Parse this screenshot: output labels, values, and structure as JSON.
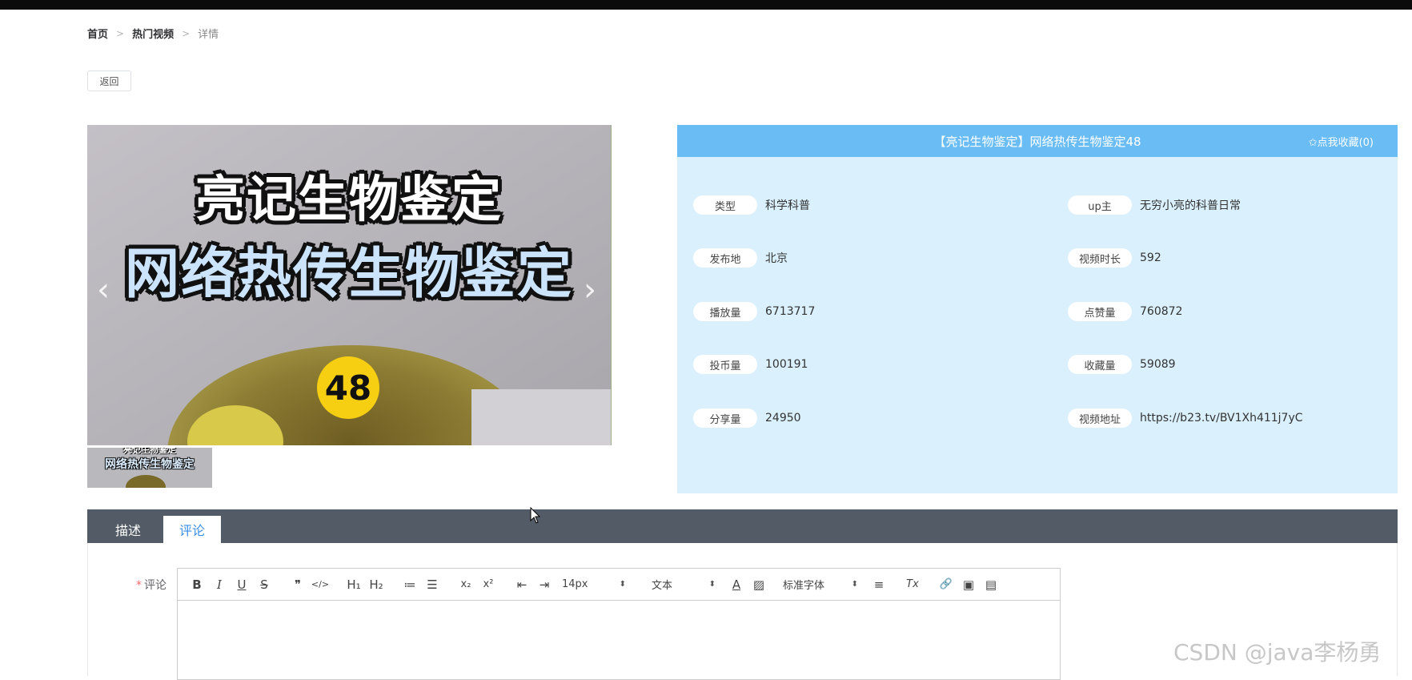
{
  "breadcrumb": {
    "home": "首页",
    "sep1": ">",
    "section": "热门视频",
    "sep2": ">",
    "current": "详情"
  },
  "back_button": "返回",
  "carousel": {
    "line1": "亮记生物鉴定",
    "line2": "网络热传生物鉴定",
    "number": "48",
    "prev_icon": "chevron-left-icon",
    "next_icon": "chevron-right-icon",
    "thumb_text_top": "亮记生物鉴定",
    "thumb_text": "网络热传生物鉴定"
  },
  "info": {
    "title": "【亮记生物鉴定】网络热传生物鉴定48",
    "favorite": "✩点我收藏(0)",
    "fields": [
      {
        "label": "类型",
        "value": "科学科普"
      },
      {
        "label": "up主",
        "value": "无穷小亮的科普日常"
      },
      {
        "label": "发布地",
        "value": "北京"
      },
      {
        "label": "视频时长",
        "value": "592"
      },
      {
        "label": "播放量",
        "value": "6713717"
      },
      {
        "label": "点赞量",
        "value": "760872"
      },
      {
        "label": "投币量",
        "value": "100191"
      },
      {
        "label": "收藏量",
        "value": "59089"
      },
      {
        "label": "分享量",
        "value": "24950"
      },
      {
        "label": "视频地址",
        "value": "https://b23.tv/BV1Xh411j7yC"
      }
    ]
  },
  "tabs": [
    {
      "label": "描述"
    },
    {
      "label": "评论"
    }
  ],
  "comment": {
    "required_mark": "*",
    "label": "评论",
    "toolbar": {
      "bold": "B",
      "italic": "I",
      "underline": "U",
      "strike": "S",
      "quote": "❞",
      "code": "</>",
      "h1": "H₁",
      "h2": "H₂",
      "ordered": "≔",
      "bullet": "☰",
      "sub": "x₂",
      "sup": "x²",
      "outdent": "⇤",
      "indent": "⇥",
      "size": "14px",
      "format": "文本",
      "color": "A",
      "bg": "▨",
      "font": "标准字体",
      "align": "≡",
      "clean": "Tx",
      "link": "🔗",
      "image": "▣",
      "video": "▤"
    }
  },
  "watermark": "CSDN @java李杨勇",
  "colors": {
    "panel_header": "#6abcf5",
    "panel_bg": "#daf0fd",
    "tabbar": "#535c66",
    "active_tab_text": "#3a8ee6"
  }
}
